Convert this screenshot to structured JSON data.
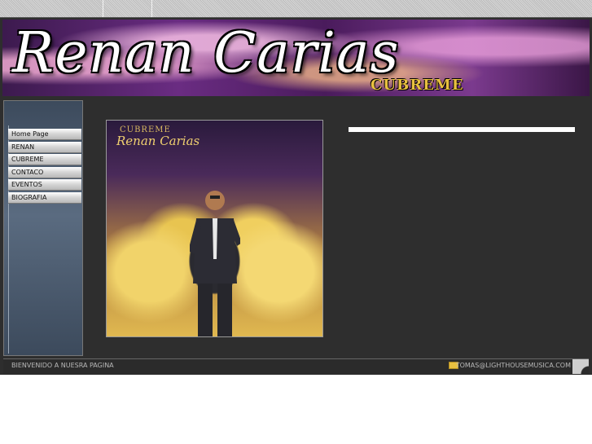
{
  "header": {
    "title": "Renan Carias",
    "subtitle": "CUBREME"
  },
  "nav": {
    "items": [
      {
        "label": "Home Page"
      },
      {
        "label": "RENAN"
      },
      {
        "label": "CUBREME"
      },
      {
        "label": "CONTACO"
      },
      {
        "label": "EVENTOS"
      },
      {
        "label": "BIOGRAFIA"
      }
    ]
  },
  "album": {
    "subtitle": "CUBREME",
    "title": "Renan Carias"
  },
  "footer": {
    "welcome": "BIENVENIDO A NUESRA PAGINA",
    "email": "TOMAS@LIGHTHOUSEMUSICA.COM"
  },
  "icons": {
    "mail": "envelope-icon"
  },
  "colors": {
    "background": "#2e2e2e",
    "accent_gold": "#e8c040",
    "banner_purple": "#6a2c82"
  }
}
